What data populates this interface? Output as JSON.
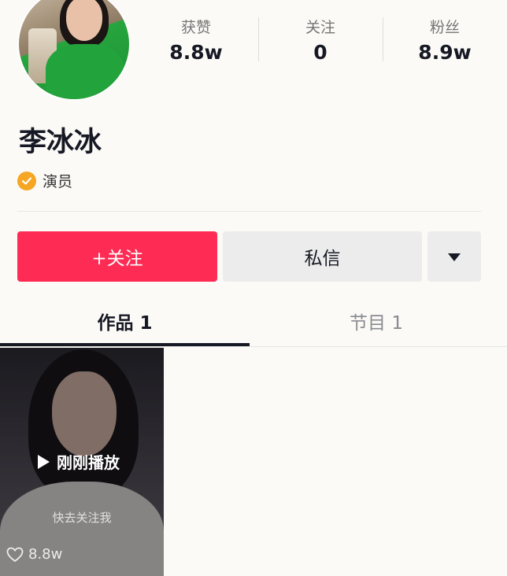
{
  "profile": {
    "name": "李冰冰",
    "verified_label": "演员"
  },
  "stats": {
    "likes_label": "获赞",
    "likes_value": "8.8w",
    "following_label": "关注",
    "following_value": "0",
    "followers_label": "粉丝",
    "followers_value": "8.9w"
  },
  "actions": {
    "follow_label": "+关注",
    "message_label": "私信",
    "more_icon": "triangle-down-icon"
  },
  "tabs": [
    {
      "label": "作品 1",
      "active": true
    },
    {
      "label": "节目 1",
      "active": false
    }
  ],
  "videos": [
    {
      "status_label": "刚刚播放",
      "subtitle": "快去关注我",
      "likes": "8.8w"
    }
  ],
  "colors": {
    "accent": "#fe2c55",
    "badge": "#f5a623",
    "text": "#161823"
  }
}
